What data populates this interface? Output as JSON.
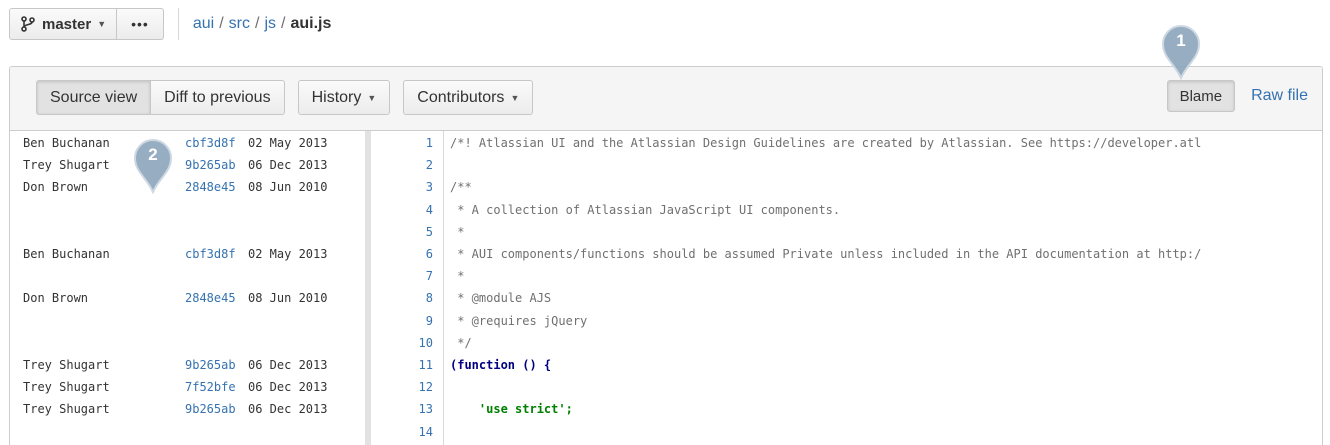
{
  "branch": {
    "name": "master",
    "more_label": "•••"
  },
  "breadcrumb": {
    "parts": [
      "aui",
      "src",
      "js"
    ],
    "file": "aui.js",
    "separator": "/"
  },
  "toolbar": {
    "source_view": "Source view",
    "diff_to_previous": "Diff to previous",
    "history": "History",
    "contributors": "Contributors",
    "blame": "Blame",
    "raw_file": "Raw file"
  },
  "callouts": {
    "first": "1",
    "second": "2"
  },
  "blame": [
    {
      "author": "Ben Buchanan",
      "commit": "cbf3d8f",
      "date": "02 May 2013",
      "line": 1
    },
    {
      "author": "Trey Shugart",
      "commit": "9b265ab",
      "date": "06 Dec 2013",
      "line": 2
    },
    {
      "author": "Don Brown",
      "commit": "2848e45",
      "date": "08 Jun 2010",
      "line": 3
    },
    {
      "author": "Ben Buchanan",
      "commit": "cbf3d8f",
      "date": "02 May 2013",
      "line": 6
    },
    {
      "author": "Don Brown",
      "commit": "2848e45",
      "date": "08 Jun 2010",
      "line": 8
    },
    {
      "author": "Trey Shugart",
      "commit": "9b265ab",
      "date": "06 Dec 2013",
      "line": 11
    },
    {
      "author": "Trey Shugart",
      "commit": "7f52bfe",
      "date": "06 Dec 2013",
      "line": 12
    },
    {
      "author": "Trey Shugart",
      "commit": "9b265ab",
      "date": "06 Dec 2013",
      "line": 13
    }
  ],
  "code_lines": [
    {
      "num": "1",
      "text": "/*! Atlassian UI and the Atlassian Design Guidelines are created by Atlassian. See https://developer.atl",
      "style": "comment"
    },
    {
      "num": "2",
      "text": "",
      "style": "plain"
    },
    {
      "num": "3",
      "text": "/**",
      "style": "comment"
    },
    {
      "num": "4",
      "text": " * A collection of Atlassian JavaScript UI components.",
      "style": "comment"
    },
    {
      "num": "5",
      "text": " *",
      "style": "comment"
    },
    {
      "num": "6",
      "text": " * AUI components/functions should be assumed Private unless included in the API documentation at http:/",
      "style": "comment"
    },
    {
      "num": "7",
      "text": " *",
      "style": "comment"
    },
    {
      "num": "8",
      "text": " * @module AJS",
      "style": "comment"
    },
    {
      "num": "9",
      "text": " * @requires jQuery",
      "style": "comment"
    },
    {
      "num": "10",
      "text": " */",
      "style": "comment"
    },
    {
      "num": "11",
      "text": "(function () {",
      "style": "kw"
    },
    {
      "num": "12",
      "text": "",
      "style": "plain"
    },
    {
      "num": "13",
      "text": "    'use strict';",
      "style": "str"
    },
    {
      "num": "14",
      "text": "",
      "style": "plain"
    }
  ],
  "colors": {
    "link": "#3572b0",
    "callout": "#8fa7bd"
  }
}
